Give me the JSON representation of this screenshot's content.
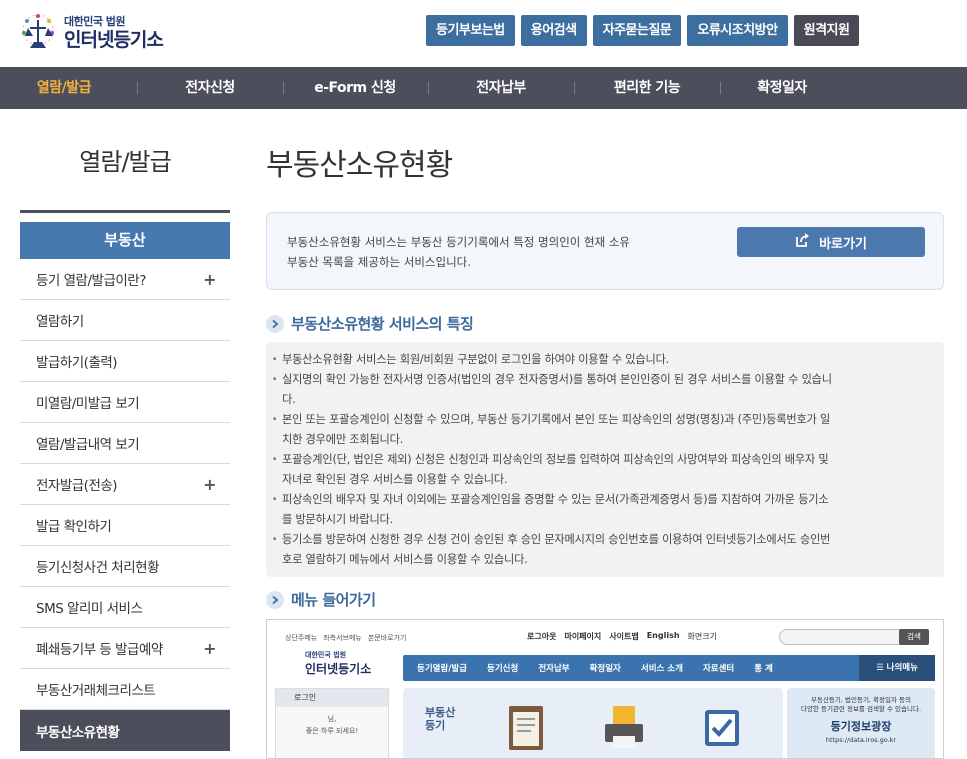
{
  "header": {
    "logo_small": "대한민국 법원",
    "logo_big": "인터넷등기소",
    "util_buttons": [
      "등기부보는법",
      "용어검색",
      "자주묻는질문",
      "오류시조치방안",
      "원격지원"
    ]
  },
  "gnb": {
    "items": [
      "열람/발급",
      "전자신청",
      "e-Form 신청",
      "전자납부",
      "편리한 기능",
      "확정일자"
    ],
    "active_index": 0
  },
  "sidebar": {
    "title": "열람/발급",
    "category": "부동산",
    "items": [
      {
        "label": "등기 열람/발급이란?",
        "expand": "+"
      },
      {
        "label": "열람하기",
        "expand": ""
      },
      {
        "label": "발급하기(출력)",
        "expand": ""
      },
      {
        "label": "미열람/미발급 보기",
        "expand": ""
      },
      {
        "label": "열람/발급내역 보기",
        "expand": ""
      },
      {
        "label": "전자발급(전송)",
        "expand": "+"
      },
      {
        "label": "발급 확인하기",
        "expand": ""
      },
      {
        "label": "등기신청사건 처리현황",
        "expand": ""
      },
      {
        "label": "SMS 알리미 서비스",
        "expand": ""
      },
      {
        "label": "폐쇄등기부 등 발급예약",
        "expand": "+"
      },
      {
        "label": "부동산거래체크리스트",
        "expand": ""
      },
      {
        "label": "부동산소유현황",
        "expand": ""
      }
    ],
    "active_index": 11
  },
  "main": {
    "page_title": "부동산소유현황",
    "intro_line1": "부동산소유현황 서비스는 부동산 등기기록에서 특정 명의인이 현재 소유",
    "intro_line2": "부동산 목록을 제공하는 서비스입니다.",
    "go_button": "바로가기",
    "features_title": "부동산소유현황 서비스의 특징",
    "features": [
      [
        "부동산소유현황 서비스는 회원/비회원 구분없이 로그인을 하여야 이용할 수 있습니다."
      ],
      [
        "실지명의 확인 가능한 전자서명 인증서(법인의 경우 전자증명서)를 통하여 본인인증이 된 경우 서비스를 이용할 수 있습니",
        "다."
      ],
      [
        "본인 또는 포괄승계인이 신청할 수 있으며, 부동산 등기기록에서 본인 또는 피상속인의 성명(명칭)과 (주민)등록번호가 일",
        "치한 경우에만 조회됩니다."
      ],
      [
        "포괄승계인(단, 법인은 제외) 신청은 신청인과 피상속인의 정보를 입력하여 피상속인의 사망여부와 피상속인의 배우자 및",
        "자녀로 확인된 경우 서비스를 이용할 수 있습니다."
      ],
      [
        "피상속인의 배우자 및 자녀 이외에는 포괄승계인임을 증명할 수 있는 문서(가족관계증명서 등)를 지참하여 가까운 등기소",
        "를 방문하시기 바랍니다."
      ],
      [
        "등기소를 방문하여 신청한 경우 신청 건이 승인된 후 승인 문자메시지의 승인번호를 이용하여 인터넷등기소에서도 승인번",
        "호로 열람하기 메뉴에서 서비스를 이용할 수 있습니다."
      ]
    ],
    "menu_title": "메뉴 들어가기"
  },
  "preview": {
    "mini_links": [
      "상단주메뉴",
      "좌측서브메뉴",
      "본문바로가기"
    ],
    "top_links": [
      "로그아웃",
      "마이페이지",
      "사이트맵",
      "English",
      "화면크기"
    ],
    "search_button": "검색",
    "logo_small": "대한민국 법원",
    "logo_big": "인터넷등기소",
    "nav": [
      "등기열람/발급",
      "등기신청",
      "전자납부",
      "확정일자",
      "서비스 소개",
      "자료센터",
      "통 계"
    ],
    "my_menu": "나의메뉴",
    "login_header": "로그인",
    "login_msg1": "님,",
    "login_msg2": "좋은 하루 되세요!",
    "banner_label1": "부동산",
    "banner_label2": "등기",
    "side_text1": "부동산등기, 법인등기, 확정일자 등의",
    "side_text2": "다양한 등기관련 정보를 검색할 수 있습니다.",
    "side_big": "등기정보광장",
    "side_url": "https://data.iros.go.kr"
  },
  "colors": {
    "gnb_bg": "#4d4e5c",
    "gnb_active": "#f0b33a",
    "accent_blue": "#4779ae",
    "util_blue": "#3c6ea0",
    "util_dark": "#4a4a57"
  }
}
